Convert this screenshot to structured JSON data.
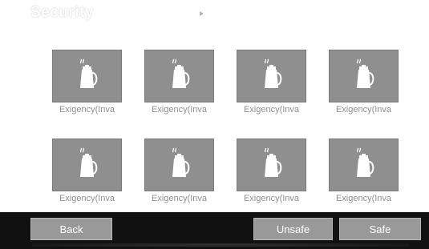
{
  "screen": {
    "title": "Security"
  },
  "tiles": [
    {
      "label": "Exigency(Inva",
      "icon": "kettle-icon"
    },
    {
      "label": "Exigency(Inva",
      "icon": "kettle-icon"
    },
    {
      "label": "Exigency(Inva",
      "icon": "kettle-icon"
    },
    {
      "label": "Exigency(Inva",
      "icon": "kettle-icon"
    },
    {
      "label": "Exigency(Inva",
      "icon": "kettle-icon"
    },
    {
      "label": "Exigency(Inva",
      "icon": "kettle-icon"
    },
    {
      "label": "Exigency(Inva",
      "icon": "kettle-icon"
    },
    {
      "label": "Exigency(Inva",
      "icon": "kettle-icon"
    }
  ],
  "buttons": {
    "back": "Back",
    "unsafe": "Unsafe",
    "safe": "Safe"
  },
  "colors": {
    "tile_background": "#8f8f8f",
    "label_text": "#8f8f8f",
    "bottom_bar": "#111111",
    "button_background": "#999999"
  }
}
